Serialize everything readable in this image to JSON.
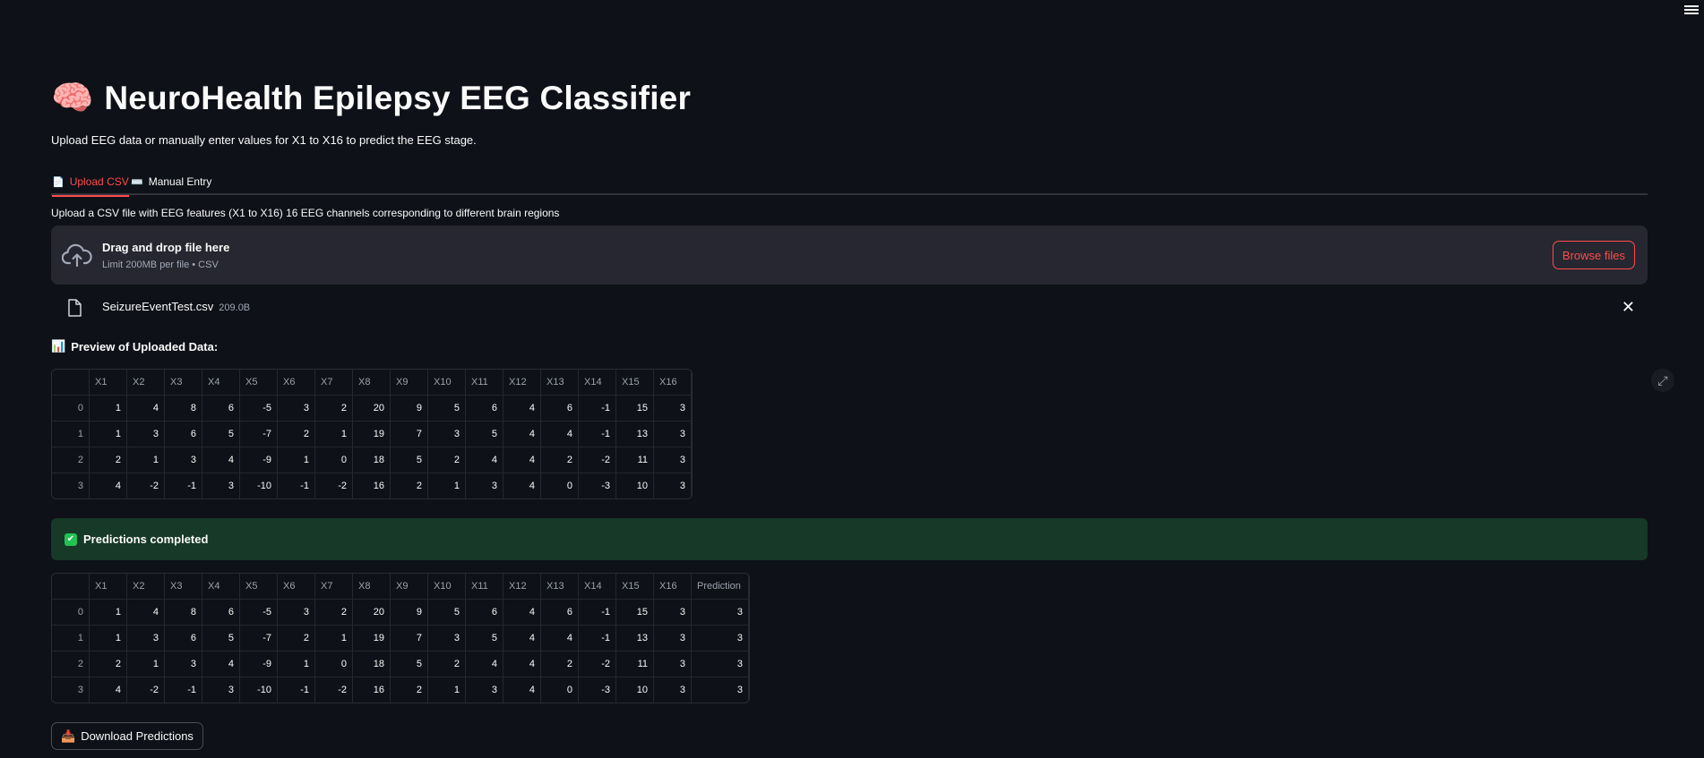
{
  "app": {
    "title_icon": "brain-emoji",
    "title": "NeuroHealth Epilepsy EEG Classifier",
    "subtitle": "Upload EEG data or manually enter values for X1 to X16 to predict the EEG stage."
  },
  "tabs": [
    {
      "label": "Upload CSV",
      "icon": "page-emoji",
      "active": true
    },
    {
      "label": "Manual Entry",
      "icon": "keyboard-emoji",
      "active": false
    }
  ],
  "upload": {
    "label": "Upload a CSV file with EEG features (X1 to X16) 16 EEG channels corresponding to different brain regions",
    "drop_title": "Drag and drop file here",
    "drop_sub": "Limit 200MB per file • CSV",
    "browse_label": "Browse files",
    "file_name": "SeizureEventTest.csv",
    "file_size": "209.0B"
  },
  "preview": {
    "label": "Preview of Uploaded Data:",
    "columns": [
      "X1",
      "X2",
      "X3",
      "X4",
      "X5",
      "X6",
      "X7",
      "X8",
      "X9",
      "X10",
      "X11",
      "X12",
      "X13",
      "X14",
      "X15",
      "X16"
    ],
    "rows": [
      {
        "index": "0",
        "values": [
          "1",
          "4",
          "8",
          "6",
          "-5",
          "3",
          "2",
          "20",
          "9",
          "5",
          "6",
          "4",
          "6",
          "-1",
          "15",
          "3"
        ]
      },
      {
        "index": "1",
        "values": [
          "1",
          "3",
          "6",
          "5",
          "-7",
          "2",
          "1",
          "19",
          "7",
          "3",
          "5",
          "4",
          "4",
          "-1",
          "13",
          "3"
        ]
      },
      {
        "index": "2",
        "values": [
          "2",
          "1",
          "3",
          "4",
          "-9",
          "1",
          "0",
          "18",
          "5",
          "2",
          "4",
          "4",
          "2",
          "-2",
          "11",
          "3"
        ]
      },
      {
        "index": "3",
        "values": [
          "4",
          "-2",
          "-1",
          "3",
          "-10",
          "-1",
          "-2",
          "16",
          "2",
          "1",
          "3",
          "4",
          "0",
          "-3",
          "10",
          "3"
        ]
      }
    ]
  },
  "success": {
    "message": "Predictions completed"
  },
  "predictions": {
    "columns": [
      "X1",
      "X2",
      "X3",
      "X4",
      "X5",
      "X6",
      "X7",
      "X8",
      "X9",
      "X10",
      "X11",
      "X12",
      "X13",
      "X14",
      "X15",
      "X16",
      "Prediction"
    ],
    "rows": [
      {
        "index": "0",
        "values": [
          "1",
          "4",
          "8",
          "6",
          "-5",
          "3",
          "2",
          "20",
          "9",
          "5",
          "6",
          "4",
          "6",
          "-1",
          "15",
          "3",
          "3"
        ]
      },
      {
        "index": "1",
        "values": [
          "1",
          "3",
          "6",
          "5",
          "-7",
          "2",
          "1",
          "19",
          "7",
          "3",
          "5",
          "4",
          "4",
          "-1",
          "13",
          "3",
          "3"
        ]
      },
      {
        "index": "2",
        "values": [
          "2",
          "1",
          "3",
          "4",
          "-9",
          "1",
          "0",
          "18",
          "5",
          "2",
          "4",
          "4",
          "2",
          "-2",
          "11",
          "3",
          "3"
        ]
      },
      {
        "index": "3",
        "values": [
          "4",
          "-2",
          "-1",
          "3",
          "-10",
          "-1",
          "-2",
          "16",
          "2",
          "1",
          "3",
          "4",
          "0",
          "-3",
          "10",
          "3",
          "3"
        ]
      }
    ]
  },
  "download": {
    "label": "Download Predictions",
    "icon": "inbox-tray-emoji"
  },
  "colors": {
    "accent": "#ff4b4b",
    "background": "#0e1117",
    "success_bg": "#173928"
  }
}
